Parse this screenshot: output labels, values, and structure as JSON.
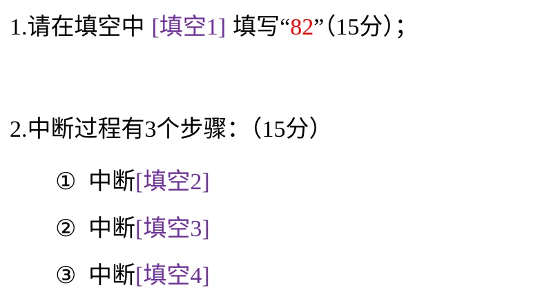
{
  "q1": {
    "number": "1.",
    "prefix": "请在填空中",
    "blank": "[填空1]",
    "verb": "填写",
    "open_quote": "“",
    "answer": "82",
    "close_quote": "”",
    "score": "（15分）；"
  },
  "q2": {
    "number": "2.",
    "text": "中断过程有3个步骤：（15分）",
    "steps": [
      {
        "marker": "①",
        "label": "中断",
        "blank": "[填空2]"
      },
      {
        "marker": "②",
        "label": "中断",
        "blank": "[填空3]"
      },
      {
        "marker": "③",
        "label": "中断",
        "blank": "[填空4]"
      }
    ]
  },
  "colors": {
    "blank": "#7030A0",
    "answer": "#FF0000",
    "text": "#000000"
  }
}
